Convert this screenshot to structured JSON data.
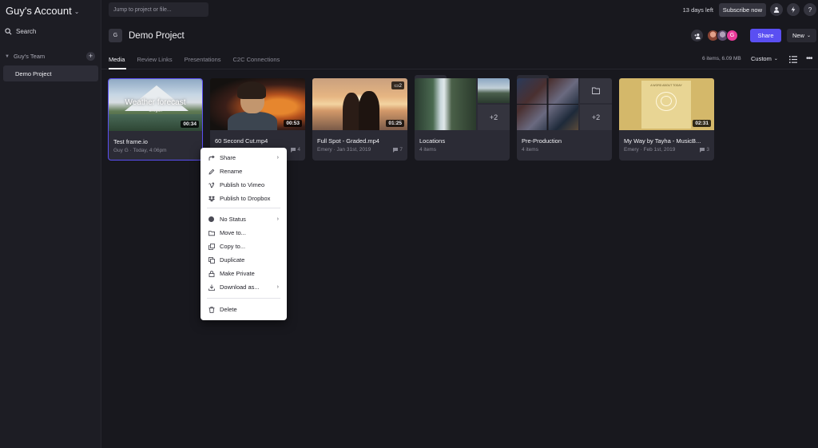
{
  "sidebar": {
    "account": "Guy's Account",
    "search": "Search",
    "team": "Guy's Team",
    "project": "Demo Project"
  },
  "topbar": {
    "jump_placeholder": "Jump to project or file...",
    "days_left": "13 days left",
    "subscribe": "Subscribe now",
    "help": "?"
  },
  "project": {
    "icon_letter": "G",
    "title": "Demo Project",
    "share": "Share",
    "new": "New",
    "avatar_letter": "G"
  },
  "tabs": [
    "Media",
    "Review Links",
    "Presentations",
    "C2C Connections"
  ],
  "toolbar": {
    "items_count": "6 items, 6.09 MB",
    "sort": "Custom"
  },
  "cards": [
    {
      "name": "Test frame.io",
      "meta": "Guy G · Today, 4:06pm",
      "duration": "00:34",
      "comments": "",
      "thumb_title": "Weather forecast",
      "thumb_sub": "Oregon"
    },
    {
      "name": "60 Second Cut.mp4",
      "meta": "",
      "duration": "00:53",
      "comments": "4"
    },
    {
      "name": "Full Spot - Graded.mp4",
      "meta": "Emery · Jan 31st, 2019",
      "duration": "01:25",
      "comments": "7",
      "version": "2"
    },
    {
      "name": "Locations",
      "meta": "4 items",
      "more": "+2"
    },
    {
      "name": "Pre-Production",
      "meta": "4 items",
      "more": "+2"
    },
    {
      "name": "My Way by Tayha - MusicB...",
      "meta": "Emery · Feb 1st, 2019",
      "duration": "02:31",
      "comments": "3",
      "thumb_text": "A WORD ABOUT TODAY"
    }
  ],
  "menu": {
    "share": "Share",
    "rename": "Rename",
    "vimeo": "Publish to Vimeo",
    "dropbox": "Publish to Dropbox",
    "status": "No Status",
    "move": "Move to...",
    "copy": "Copy to...",
    "duplicate": "Duplicate",
    "private": "Make Private",
    "download": "Download as...",
    "delete": "Delete"
  },
  "colors": {
    "accent": "#5a4ff2",
    "background": "#18181e",
    "sidebar": "#1d1d24",
    "card": "#2b2b35"
  }
}
